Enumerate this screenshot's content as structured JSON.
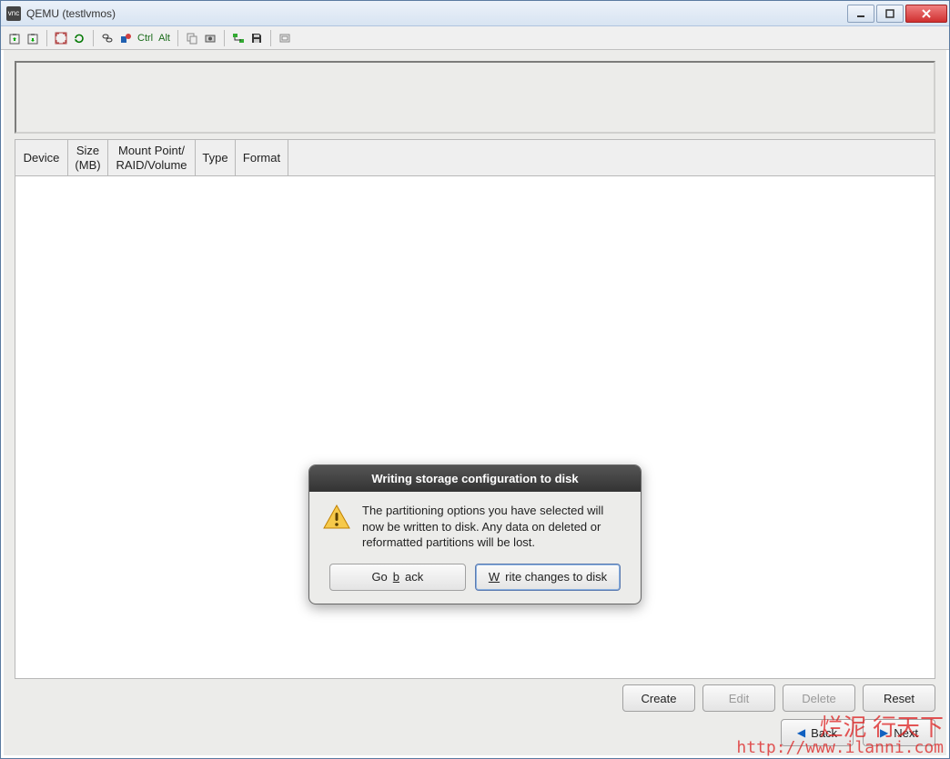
{
  "window": {
    "title": "QEMU (testlvmos)"
  },
  "toolbar": {
    "ctrl": "Ctrl",
    "alt": "Alt"
  },
  "table": {
    "headers": {
      "device": "Device",
      "size": "Size\n(MB)",
      "mount": "Mount Point/\nRAID/Volume",
      "type": "Type",
      "format": "Format"
    }
  },
  "buttons": {
    "create": "Create",
    "edit": "Edit",
    "delete": "Delete",
    "reset": "Reset",
    "back": "Back",
    "next": "Next"
  },
  "dialog": {
    "title": "Writing storage configuration to disk",
    "message": "The partitioning options you have selected will now be written to disk.  Any data on deleted or reformatted partitions will be lost.",
    "go_back": "Go back",
    "write": "Write changes to disk"
  },
  "watermark": {
    "text": "烂泥 行天下",
    "url": "http://www.ilanni.com"
  }
}
